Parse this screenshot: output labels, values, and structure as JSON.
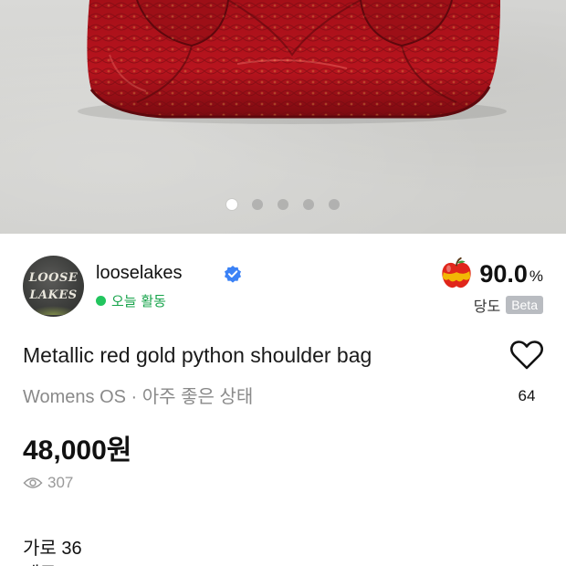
{
  "photo": {
    "carousel": {
      "count": 5,
      "active_index": 0
    },
    "colors": {
      "bag": "#b3121b",
      "bag_dark": "#6e0b10",
      "wall": "#d6d6d3"
    }
  },
  "seller": {
    "name": "looselakes",
    "avatar_text_line1": "LOOSE",
    "avatar_text_line2": "LAKES",
    "activity": "오늘 활동",
    "activity_color": "#22c55e",
    "verified_color": "#3b82f6"
  },
  "score": {
    "value": "90.0",
    "unit": "%",
    "label": "당도",
    "badge": "Beta"
  },
  "product": {
    "title": "Metallic red gold python shoulder bag",
    "subtitle": "Womens OS · 아주 좋은 상태",
    "price": "48,000원",
    "views": "307",
    "likes": "64"
  },
  "description": {
    "line1": "가로 36",
    "line2": "세로"
  },
  "icons": {
    "verified": "verified-check-icon",
    "score": "apple-icon",
    "like": "heart-icon",
    "views": "eye-icon"
  }
}
